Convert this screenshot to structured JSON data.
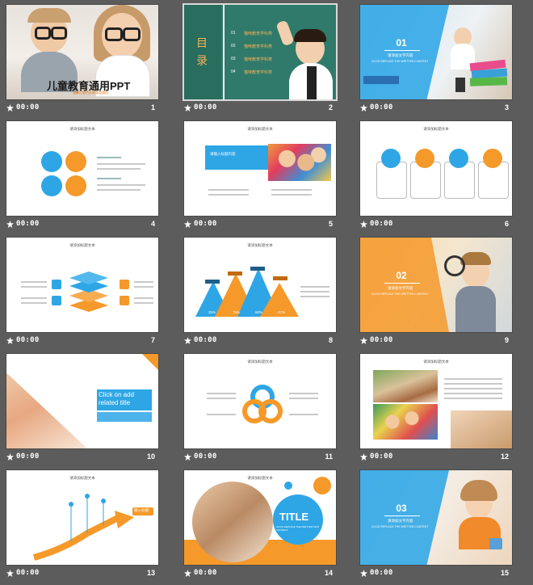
{
  "colors": {
    "accent_blue": "#2ea6e6",
    "accent_orange": "#f5992a",
    "panel_bg": "#5c5c5c",
    "board_green": "#2f7a6a"
  },
  "slides": [
    {
      "number": "1",
      "time": "00:00",
      "title": "儿童教育通用PPT",
      "subtitle": "温馨可爱色彩教育类通用"
    },
    {
      "number": "2",
      "time": "00:00",
      "heading": "目录",
      "items": [
        "猫咪教育学科类",
        "猫咪教育学科类",
        "猫咪教育学科类",
        "猫咪教育学科类"
      ],
      "index": [
        "01",
        "02",
        "03",
        "04"
      ]
    },
    {
      "number": "3",
      "time": "00:00",
      "badge": "01",
      "label": "请添加文字内容",
      "sublabel": "CLICK REPLACE THE WRITTEN CONTENT"
    },
    {
      "number": "4",
      "time": "00:00",
      "title": "请添加标题文本"
    },
    {
      "number": "5",
      "time": "00:00",
      "title": "请添加标题文本",
      "box": "请输入标题内容"
    },
    {
      "number": "6",
      "time": "00:00",
      "title": "请添加标题文本"
    },
    {
      "number": "7",
      "time": "00:00",
      "title": "请添加标题文本"
    },
    {
      "number": "8",
      "time": "00:00",
      "title": "请添加标题文本",
      "percents": [
        "25%",
        "75%",
        "60%",
        "47%"
      ]
    },
    {
      "number": "9",
      "time": "00:00",
      "badge": "02",
      "label": "请添加文字内容",
      "sublabel": "CLICK REPLACE THE WRITTEN CONTENT"
    },
    {
      "number": "10",
      "time": "00:00",
      "heading": "Click on add related title"
    },
    {
      "number": "11",
      "time": "00:00",
      "title": "请添加标题文本"
    },
    {
      "number": "12",
      "time": "00:00",
      "title": "请添加标题文本"
    },
    {
      "number": "13",
      "time": "00:00",
      "title": "请添加标题文本",
      "tag": "输入标题"
    },
    {
      "number": "14",
      "time": "00:00",
      "title": "请添加标题文本",
      "big": "TITLE",
      "sub": "CLICK REPLACE THE WRITTEN TEXT CONTENT"
    },
    {
      "number": "15",
      "time": "00:00",
      "badge": "03",
      "label": "请添加文字内容",
      "sublabel": "CLICK REPLACE THE WRITTEN CONTENT"
    }
  ]
}
